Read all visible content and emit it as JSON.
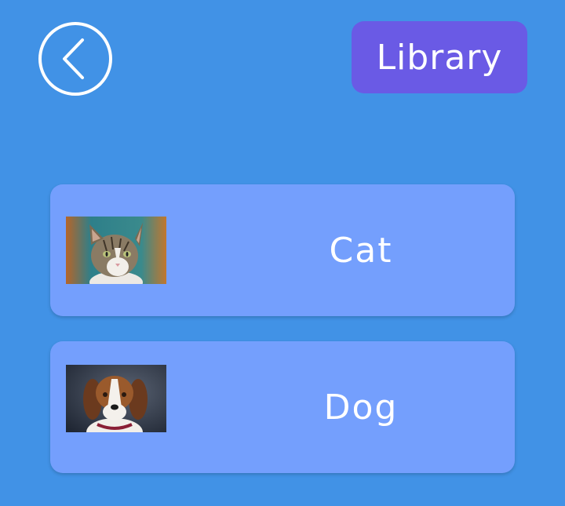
{
  "header": {
    "back_icon": "chevron-left-circle-icon",
    "library_label": "Library"
  },
  "cards": [
    {
      "label": "Cat",
      "image": "cat-photo"
    },
    {
      "label": "Dog",
      "image": "dog-photo"
    }
  ],
  "colors": {
    "background": "#4192e6",
    "library_button": "#6a5ae5",
    "card": "#749ffd",
    "text": "#ffffff"
  }
}
